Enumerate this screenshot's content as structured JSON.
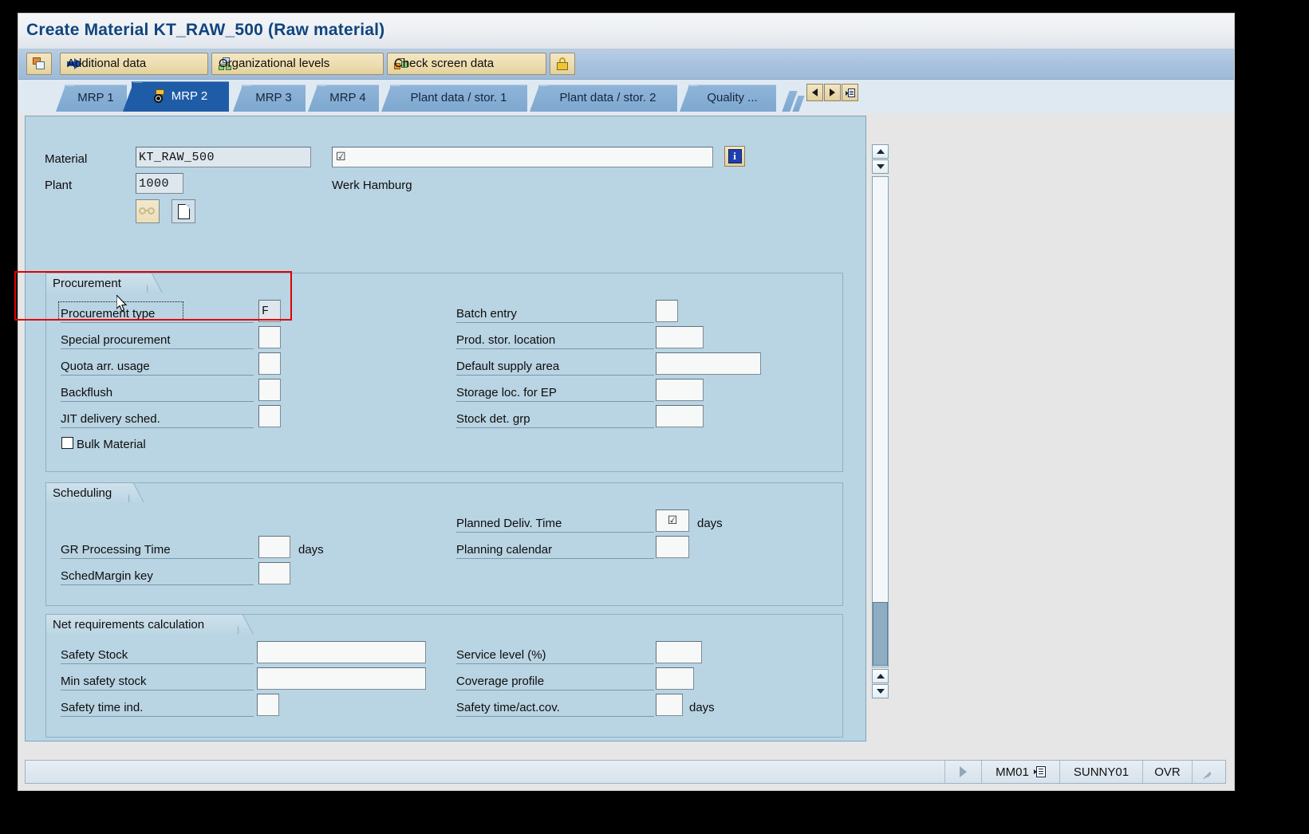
{
  "window": {
    "title": "Create Material KT_RAW_500 (Raw material)"
  },
  "toolbar": {
    "copy_icon": "copy-icon",
    "buttons": [
      {
        "label": "Additional data",
        "icon": "arrow-right-icon"
      },
      {
        "label": "Organizational levels",
        "icon": "org-levels-icon"
      },
      {
        "label": "Check screen data",
        "icon": "check-screen-icon"
      }
    ],
    "lock_icon": "lock-icon"
  },
  "tabs": {
    "items": [
      {
        "label": "MRP 1",
        "active": false
      },
      {
        "label": "MRP 2",
        "active": true
      },
      {
        "label": "MRP 3",
        "active": false
      },
      {
        "label": "MRP 4",
        "active": false
      },
      {
        "label": "Plant data / stor. 1",
        "active": false
      },
      {
        "label": "Plant data / stor. 2",
        "active": false
      },
      {
        "label": "Quality ...",
        "active": false
      }
    ],
    "nav": {
      "prev_icon": "triangle-left-icon",
      "next_icon": "triangle-right-icon",
      "list_icon": "tab-list-icon"
    }
  },
  "header": {
    "material_label": "Material",
    "material_value": "KT_RAW_500",
    "material_desc_value": "",
    "material_desc_check": "☑",
    "help_icon": "info-help-icon",
    "plant_label": "Plant",
    "plant_value": "1000",
    "plant_desc": "Werk Hamburg",
    "glasses_icon": "glasses-icon",
    "page_icon": "document-icon"
  },
  "procurement": {
    "title": "Procurement",
    "left": [
      {
        "label": "Procurement type",
        "value": "F",
        "type": "text",
        "focused": true
      },
      {
        "label": "Special procurement",
        "value": "",
        "type": "text"
      },
      {
        "label": "Quota arr. usage",
        "value": "",
        "type": "text"
      },
      {
        "label": "Backflush",
        "value": "",
        "type": "text"
      },
      {
        "label": "JIT delivery sched.",
        "value": "",
        "type": "text"
      }
    ],
    "bulk_material": {
      "label": "Bulk Material",
      "checked": false
    },
    "right": [
      {
        "label": "Batch entry",
        "value": "",
        "type": "text"
      },
      {
        "label": "Prod. stor. location",
        "value": "",
        "type": "text"
      },
      {
        "label": "Default supply area",
        "value": "",
        "type": "text"
      },
      {
        "label": "Storage loc. for EP",
        "value": "",
        "type": "text"
      },
      {
        "label": "Stock det. grp",
        "value": "",
        "type": "text"
      }
    ]
  },
  "scheduling": {
    "title": "Scheduling",
    "left": [
      {
        "label": "GR Processing Time",
        "value": "",
        "unit": "days"
      },
      {
        "label": "SchedMargin key",
        "value": "",
        "unit": ""
      }
    ],
    "right": [
      {
        "label": "Planned Deliv. Time",
        "value": "☑",
        "unit": "days"
      },
      {
        "label": "Planning calendar",
        "value": "",
        "unit": ""
      }
    ]
  },
  "net_requirements": {
    "title": "Net requirements calculation",
    "left": [
      {
        "label": "Safety Stock",
        "value": "",
        "unit": ""
      },
      {
        "label": "Min safety stock",
        "value": "",
        "unit": ""
      },
      {
        "label": "Safety time ind.",
        "value": "",
        "unit": ""
      }
    ],
    "right": [
      {
        "label": "Service level (%)",
        "value": "",
        "unit": ""
      },
      {
        "label": "Coverage profile",
        "value": "",
        "unit": ""
      },
      {
        "label": "Safety time/act.cov.",
        "value": "",
        "unit": "days"
      }
    ]
  },
  "status_bar": {
    "play_icon": "play-triangle-icon",
    "transaction": "MM01",
    "transaction_icon": "transaction-list-icon",
    "system": "SUNNY01",
    "mode": "OVR",
    "resize_icon": "resize-grip-icon"
  },
  "annotation": {
    "highlight_label": "procurement-type-highlight",
    "color": "#e00000"
  },
  "colors": {
    "title_text": "#10457e",
    "active_tab": "#1f5ca8",
    "form_bg": "#b9d4e3",
    "toolbar_bg": "#a8c2dd",
    "button_cream": "#ecdcae"
  }
}
